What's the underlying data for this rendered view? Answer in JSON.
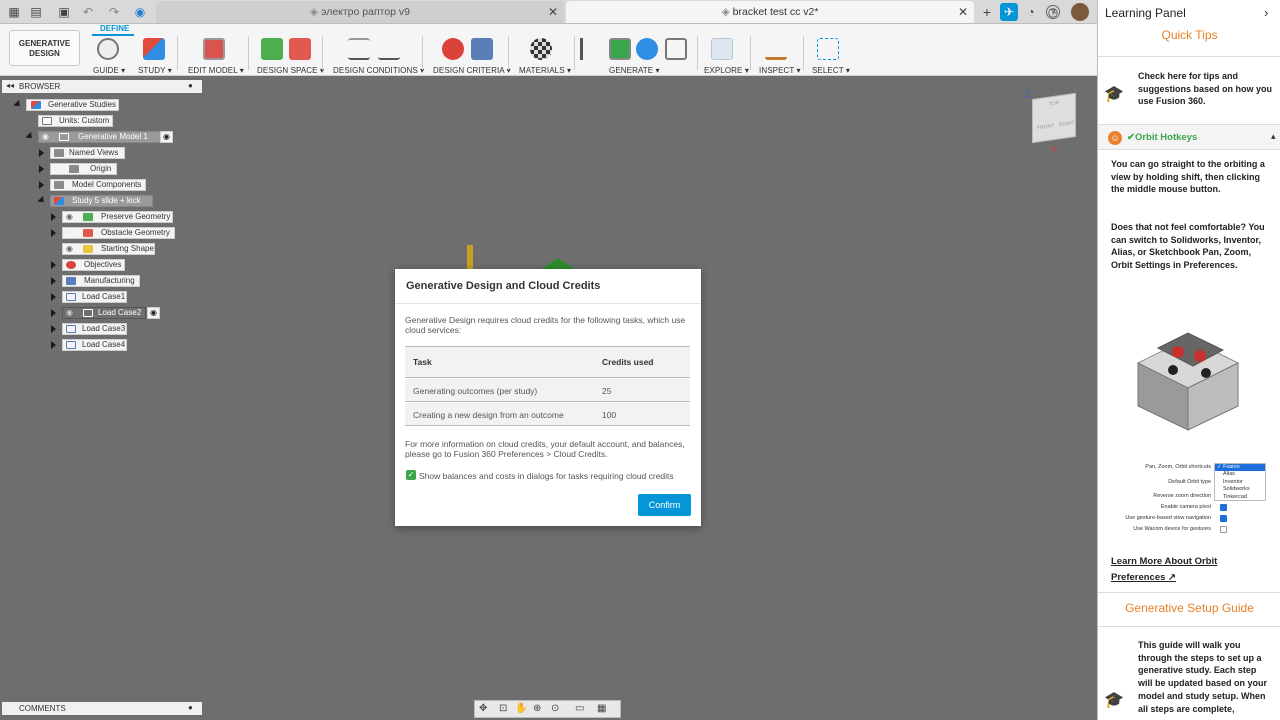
{
  "tabs": [
    {
      "label": "электро раптор v9",
      "active": false
    },
    {
      "label": "bracket test cc v2*",
      "active": true
    }
  ],
  "ribbon": {
    "workspace": "GENERATIVE\nDESIGN",
    "mode_tab": "DEFINE",
    "groups": [
      {
        "label": "GUIDE ▾"
      },
      {
        "label": "STUDY ▾"
      },
      {
        "label": "EDIT MODEL ▾"
      },
      {
        "label": "DESIGN SPACE ▾"
      },
      {
        "label": "DESIGN CONDITIONS ▾"
      },
      {
        "label": "DESIGN CRITERIA ▾"
      },
      {
        "label": "MATERIALS ▾"
      },
      {
        "label": "GENERATE ▾"
      },
      {
        "label": "EXPLORE ▾"
      },
      {
        "label": "INSPECT ▾"
      },
      {
        "label": "SELECT ▾"
      }
    ]
  },
  "browser": {
    "title": "BROWSER",
    "nodes": [
      {
        "label": "Generative Studies"
      },
      {
        "label": "Units: Custom"
      },
      {
        "label": "Generative Model 1"
      },
      {
        "label": "Named Views"
      },
      {
        "label": "Origin"
      },
      {
        "label": "Model Components"
      },
      {
        "label": "Study 5 slide + kick"
      },
      {
        "label": "Preserve Geometry"
      },
      {
        "label": "Obstacle Geometry"
      },
      {
        "label": "Starting Shape"
      },
      {
        "label": "Objectives"
      },
      {
        "label": "Manufacturing"
      },
      {
        "label": "Load Case1"
      },
      {
        "label": "Load Case2"
      },
      {
        "label": "Load Case3"
      },
      {
        "label": "Load Case4"
      }
    ]
  },
  "comments": {
    "label": "COMMENTS"
  },
  "viewcube": {
    "top": "TOP",
    "front": "FRONT",
    "right": "RIGHT",
    "axis_z": "Z",
    "axis_x": "X"
  },
  "dialog": {
    "title": "Generative Design and Cloud Credits",
    "intro": "Generative Design requires cloud credits for the following tasks, which use cloud services:",
    "table_headers": [
      "Task",
      "Credits used"
    ],
    "rows": [
      {
        "task": "Generating outcomes (per study)",
        "credits": "25"
      },
      {
        "task": "Creating a new design from an outcome",
        "credits": "100"
      }
    ],
    "info": "For more information on cloud credits, your default account, and balances, please go to Fusion 360 Preferences > Cloud Credits.",
    "checkbox_label": "Show balances and costs in dialogs for tasks requiring cloud credits",
    "checkbox_checked": true,
    "confirm": "Confirm"
  },
  "learning_panel": {
    "title": "Learning Panel",
    "quick_tips_heading": "Quick Tips",
    "quick_tips_text": "Check here for tips and suggestions based on how you use Fusion 360.",
    "orbit_heading": "✔Orbit Hotkeys",
    "orbit_p1": "You can go straight to the orbiting a view by holding shift, then clicking the middle mouse button.",
    "orbit_p2": "Does that not feel comfortable? You can switch to Solidworks, Inventor, Alias, or Sketchbook Pan, Zoom, Orbit Settings in Preferences.",
    "prefs": {
      "rows": [
        "Pan, Zoom, Orbit shortcuts",
        "Default Orbit type",
        "Reverse zoom direction",
        "Enable camera pivot",
        "Use gesture-based view navigation",
        "Use Wacom device for gestures"
      ],
      "options": [
        "✓ Fusion",
        "Alias",
        "Inventor",
        "Solidworks",
        "Tinkercad"
      ]
    },
    "learn_more": "Learn More About Orbit Preferences",
    "setup_heading": "Generative Setup Guide",
    "setup_text": "This guide will walk you through the steps to set up a generative study. Each step will be updated based on your model and study setup. When all steps are complete,"
  },
  "colors": {
    "accent": "#0696d7",
    "orange": "#e8822a",
    "green_check": "#3aa64b"
  }
}
